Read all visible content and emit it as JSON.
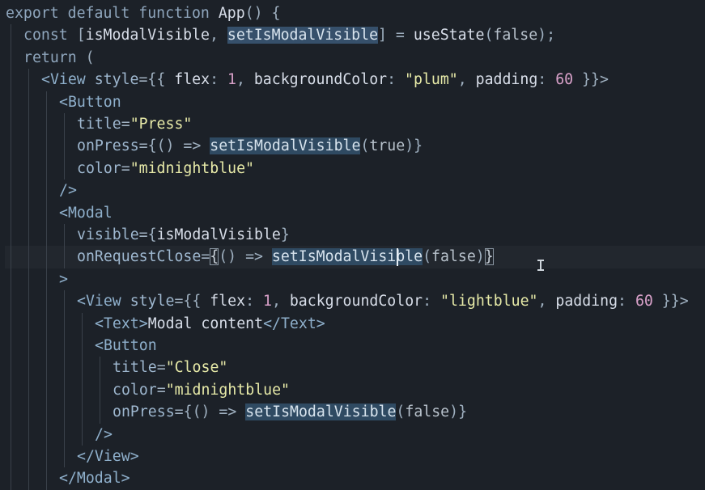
{
  "editor": {
    "lines": [
      {
        "indent": 0,
        "tokens": [
          [
            "export",
            "k"
          ],
          [
            " ",
            "p"
          ],
          [
            "default",
            "k"
          ],
          [
            " ",
            "p"
          ],
          [
            "function",
            "k"
          ],
          [
            " ",
            "p"
          ],
          [
            "App",
            "f"
          ],
          [
            "()",
            "p"
          ],
          [
            " {",
            "p"
          ]
        ]
      },
      {
        "indent": 1,
        "tokens": [
          [
            "const",
            "k"
          ],
          [
            " [",
            "p"
          ],
          [
            "isModalVisible",
            "v"
          ],
          [
            ", ",
            "p"
          ],
          [
            "setIsModalVisible",
            "hl"
          ],
          [
            "] = ",
            "p"
          ],
          [
            "useState",
            "f"
          ],
          [
            "(",
            "p"
          ],
          [
            "false",
            "b"
          ],
          [
            ");",
            "p"
          ]
        ]
      },
      {
        "indent": 1,
        "tokens": [
          [
            "return",
            "k"
          ],
          [
            " (",
            "p"
          ]
        ]
      },
      {
        "indent": 2,
        "tokens": [
          [
            "<",
            "tag"
          ],
          [
            "View",
            "tag"
          ],
          [
            " ",
            "p"
          ],
          [
            "style",
            "a"
          ],
          [
            "={{ ",
            "p"
          ],
          [
            "flex",
            "v"
          ],
          [
            ": ",
            "p"
          ],
          [
            "1",
            "n"
          ],
          [
            ", ",
            "p"
          ],
          [
            "backgroundColor",
            "v"
          ],
          [
            ": ",
            "p"
          ],
          [
            "\"plum\"",
            "s"
          ],
          [
            ", ",
            "p"
          ],
          [
            "padding",
            "v"
          ],
          [
            ": ",
            "p"
          ],
          [
            "60",
            "n"
          ],
          [
            " }}>",
            "p"
          ]
        ]
      },
      {
        "indent": 3,
        "tokens": [
          [
            "<",
            "tag"
          ],
          [
            "Button",
            "tag"
          ]
        ]
      },
      {
        "indent": 4,
        "tokens": [
          [
            "title",
            "a"
          ],
          [
            "=",
            "p"
          ],
          [
            "\"Press\"",
            "s"
          ]
        ]
      },
      {
        "indent": 4,
        "tokens": [
          [
            "onPress",
            "a"
          ],
          [
            "={",
            "p"
          ],
          [
            "() => ",
            "p"
          ],
          [
            "setIsModalVisible",
            "hl2"
          ],
          [
            "(",
            "p"
          ],
          [
            "true",
            "b"
          ],
          [
            ")}",
            "p"
          ]
        ]
      },
      {
        "indent": 4,
        "tokens": [
          [
            "color",
            "a"
          ],
          [
            "=",
            "p"
          ],
          [
            "\"midnightblue\"",
            "s"
          ]
        ]
      },
      {
        "indent": 3,
        "tokens": [
          [
            "/>",
            "tag"
          ]
        ]
      },
      {
        "indent": 3,
        "tokens": [
          [
            "<",
            "tag"
          ],
          [
            "Modal",
            "tag"
          ]
        ]
      },
      {
        "indent": 4,
        "tokens": [
          [
            "visible",
            "a"
          ],
          [
            "={",
            "p"
          ],
          [
            "isModalVisible",
            "v"
          ],
          [
            "}",
            "p"
          ]
        ]
      },
      {
        "indent": 4,
        "current": true,
        "tokens": [
          [
            "onRequestClose",
            "a"
          ],
          [
            "=",
            "p"
          ],
          [
            "{",
            "brk"
          ],
          [
            "() => ",
            "p"
          ],
          [
            "setIsModalVisible",
            "hl2"
          ],
          [
            "(",
            "p"
          ],
          [
            "false",
            "b"
          ],
          [
            ")",
            "p"
          ],
          [
            "}",
            "brk"
          ]
        ]
      },
      {
        "indent": 3,
        "tokens": [
          [
            ">",
            "tag"
          ]
        ]
      },
      {
        "indent": 4,
        "tokens": [
          [
            "<",
            "tag"
          ],
          [
            "View",
            "tag"
          ],
          [
            " ",
            "p"
          ],
          [
            "style",
            "a"
          ],
          [
            "={{ ",
            "p"
          ],
          [
            "flex",
            "v"
          ],
          [
            ": ",
            "p"
          ],
          [
            "1",
            "n"
          ],
          [
            ", ",
            "p"
          ],
          [
            "backgroundColor",
            "v"
          ],
          [
            ": ",
            "p"
          ],
          [
            "\"lightblue\"",
            "s"
          ],
          [
            ", ",
            "p"
          ],
          [
            "padding",
            "v"
          ],
          [
            ": ",
            "p"
          ],
          [
            "60",
            "n"
          ],
          [
            " }}>",
            "p"
          ]
        ]
      },
      {
        "indent": 5,
        "tokens": [
          [
            "<",
            "tag"
          ],
          [
            "Text",
            "tag"
          ],
          [
            ">",
            "tag"
          ],
          [
            "Modal content",
            "v"
          ],
          [
            "</",
            "tag"
          ],
          [
            "Text",
            "tag"
          ],
          [
            ">",
            "tag"
          ]
        ]
      },
      {
        "indent": 5,
        "tokens": [
          [
            "<",
            "tag"
          ],
          [
            "Button",
            "tag"
          ]
        ]
      },
      {
        "indent": 6,
        "tokens": [
          [
            "title",
            "a"
          ],
          [
            "=",
            "p"
          ],
          [
            "\"Close\"",
            "s"
          ]
        ]
      },
      {
        "indent": 6,
        "tokens": [
          [
            "color",
            "a"
          ],
          [
            "=",
            "p"
          ],
          [
            "\"midnightblue\"",
            "s"
          ]
        ]
      },
      {
        "indent": 6,
        "tokens": [
          [
            "onPress",
            "a"
          ],
          [
            "={",
            "p"
          ],
          [
            "() => ",
            "p"
          ],
          [
            "setIsModalVisible",
            "hl2"
          ],
          [
            "(",
            "p"
          ],
          [
            "false",
            "b"
          ],
          [
            ")}",
            "p"
          ]
        ]
      },
      {
        "indent": 5,
        "tokens": [
          [
            "/>",
            "tag"
          ]
        ]
      },
      {
        "indent": 4,
        "tokens": [
          [
            "</",
            "tag"
          ],
          [
            "View",
            "tag"
          ],
          [
            ">",
            "tag"
          ]
        ]
      },
      {
        "indent": 3,
        "tokens": [
          [
            "</",
            "tag"
          ],
          [
            "Modal",
            "tag"
          ],
          [
            ">",
            "tag"
          ]
        ]
      }
    ]
  },
  "colors": {
    "background": "#1c2128",
    "current_line": "#22272e",
    "selection": "#36506b",
    "indent_guide": "#3a414a"
  },
  "icons": {
    "mouse_pointer": "i-beam-cursor-icon"
  }
}
